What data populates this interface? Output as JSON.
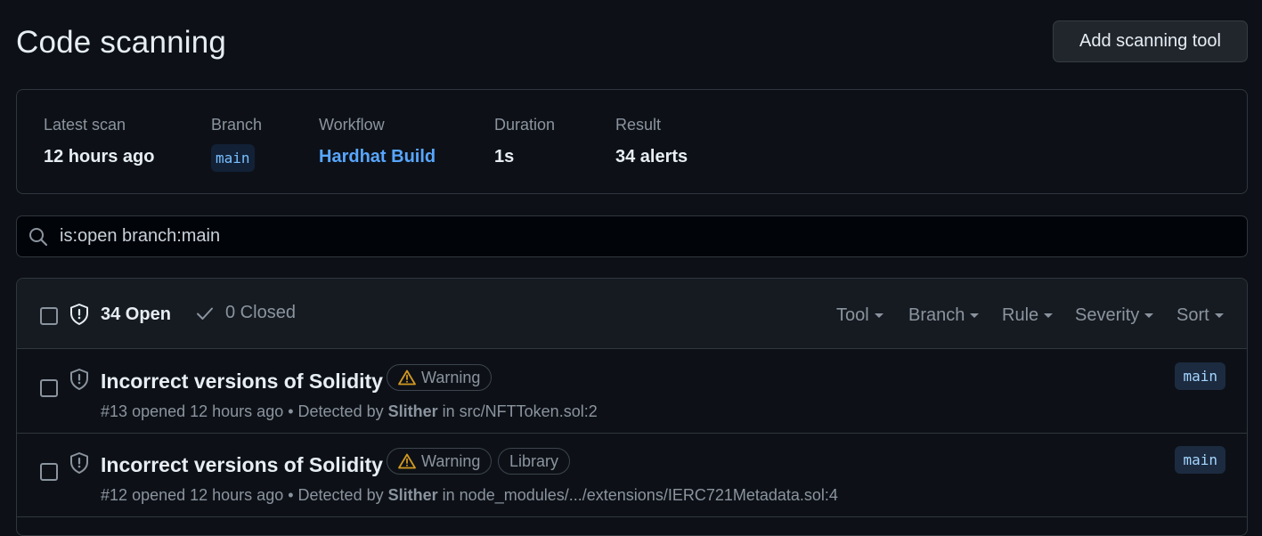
{
  "page": {
    "title": "Code scanning",
    "add_tool_label": "Add scanning tool"
  },
  "scan": {
    "latest_scan_label": "Latest scan",
    "latest_scan_value": "12 hours ago",
    "branch_label": "Branch",
    "branch_value": "main",
    "workflow_label": "Workflow",
    "workflow_value": "Hardhat Build",
    "duration_label": "Duration",
    "duration_value": "1s",
    "result_label": "Result",
    "result_value": "34 alerts"
  },
  "search": {
    "value": "is:open branch:main",
    "icon": "search-icon"
  },
  "alerts": {
    "open_label": "34 Open",
    "closed_label": "0 Closed",
    "filters": [
      "Tool",
      "Branch",
      "Rule",
      "Severity",
      "Sort"
    ],
    "items": [
      {
        "title": "Incorrect versions of Solidity",
        "severity": "Warning",
        "tags": [],
        "number": "#13",
        "opened": "opened 12 hours ago",
        "detected_prefix": "• Detected by",
        "tool": "Slither",
        "location_prefix": "in",
        "location": "src/NFTToken.sol:2",
        "branch": "main"
      },
      {
        "title": "Incorrect versions of Solidity",
        "severity": "Warning",
        "tags": [
          "Library"
        ],
        "number": "#12",
        "opened": "opened 12 hours ago",
        "detected_prefix": "• Detected by",
        "tool": "Slither",
        "location_prefix": "in",
        "location": "node_modules/.../extensions/IERC721Metadata.sol:4",
        "branch": "main"
      }
    ]
  },
  "colors": {
    "background": "#0d1117",
    "link": "#58a6ff",
    "warning": "#d29922",
    "muted": "#8b949e"
  }
}
